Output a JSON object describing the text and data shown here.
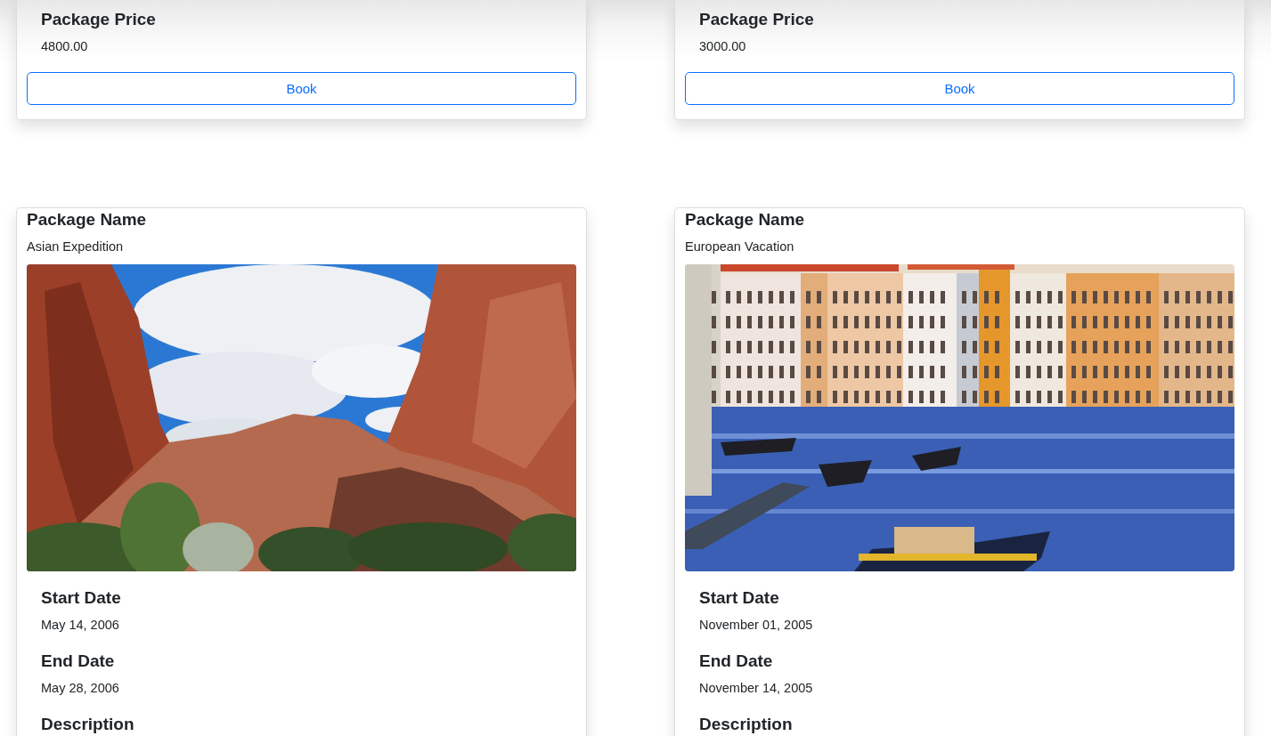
{
  "cards_row_1": [
    {
      "fields": [
        {
          "label": "Package Price",
          "value": "4800.00"
        }
      ],
      "button": "Book"
    },
    {
      "fields": [
        {
          "label": "Package Price",
          "value": "3000.00"
        }
      ],
      "button": "Book"
    }
  ],
  "cards_row_2": [
    {
      "title_field": {
        "label": "Package Name",
        "value": "Asian Expedition"
      },
      "fields": [
        {
          "label": "Start Date",
          "value": "May 14, 2006"
        },
        {
          "label": "End Date",
          "value": "May 28, 2006"
        },
        {
          "label": "Description"
        }
      ]
    },
    {
      "title_field": {
        "label": "Package Name",
        "value": "European Vacation"
      },
      "fields": [
        {
          "label": "Start Date",
          "value": "November 01, 2005"
        },
        {
          "label": "End Date",
          "value": "November 14, 2005"
        },
        {
          "label": "Description"
        }
      ]
    }
  ]
}
